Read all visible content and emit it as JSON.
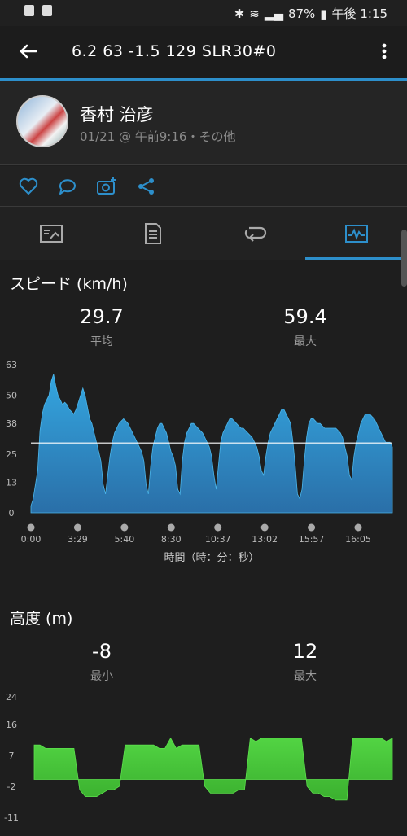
{
  "status_bar": {
    "battery": "87%",
    "time": "午後 1:15"
  },
  "app_bar": {
    "title": "6.2  63  -1.5  129  SLR30#0"
  },
  "user": {
    "name": "香村 治彦",
    "meta": "01/21 @ 午前9:16・その他"
  },
  "tabs": [
    "overview",
    "details",
    "laps",
    "charts"
  ],
  "speed": {
    "title": "スピード (km/h)",
    "avg_value": "29.7",
    "avg_label": "平均",
    "max_value": "59.4",
    "max_label": "最大",
    "x_axis_label": "時間（時：分：秒）",
    "color": "#2d8fcb"
  },
  "altitude": {
    "title": "高度 (m)",
    "min_value": "-8",
    "min_label": "最小",
    "max_value": "12",
    "max_label": "最大",
    "color": "#46c93a"
  },
  "chart_data": [
    {
      "type": "area",
      "title": "スピード (km/h)",
      "xlabel": "時間（時：分：秒）",
      "ylabel": "",
      "y_ticks": [
        "63",
        "50",
        "38",
        "25",
        "13",
        "0"
      ],
      "x_ticks": [
        "0:00",
        "3:29",
        "5:40",
        "8:30",
        "10:37",
        "13:02",
        "15:57",
        "16:05"
      ],
      "ylim": [
        0,
        63
      ],
      "average_line": 29.7,
      "values": [
        3,
        6,
        12,
        18,
        35,
        42,
        46,
        48,
        50,
        56,
        59,
        54,
        50,
        48,
        46,
        47,
        46,
        44,
        43,
        42,
        44,
        47,
        50,
        53,
        50,
        45,
        40,
        38,
        34,
        30,
        26,
        22,
        12,
        8,
        16,
        24,
        30,
        34,
        36,
        38,
        39,
        40,
        39,
        38,
        36,
        34,
        32,
        30,
        28,
        26,
        22,
        12,
        8,
        20,
        28,
        32,
        36,
        38,
        38,
        36,
        34,
        30,
        26,
        24,
        20,
        10,
        8,
        22,
        30,
        34,
        36,
        38,
        38,
        37,
        36,
        35,
        34,
        32,
        30,
        28,
        24,
        16,
        10,
        20,
        30,
        34,
        36,
        38,
        40,
        40,
        39,
        38,
        37,
        36,
        36,
        35,
        34,
        33,
        32,
        30,
        28,
        24,
        18,
        16,
        24,
        30,
        34,
        36,
        38,
        40,
        42,
        44,
        44,
        42,
        40,
        38,
        30,
        20,
        8,
        6,
        10,
        22,
        32,
        38,
        40,
        40,
        39,
        38,
        38,
        37,
        36,
        36,
        36,
        36,
        36,
        36,
        35,
        34,
        32,
        28,
        24,
        16,
        14,
        24,
        30,
        34,
        38,
        40,
        42,
        42,
        42,
        41,
        40,
        38,
        36,
        34,
        32,
        30,
        30,
        30,
        28
      ]
    },
    {
      "type": "area",
      "title": "高度 (m)",
      "y_ticks": [
        "24",
        "16",
        "7",
        "-2",
        "-11"
      ],
      "ylim": [
        -11,
        24
      ],
      "values": [
        10,
        10,
        9,
        9,
        9,
        9,
        9,
        9,
        -3,
        -5,
        -5,
        -5,
        -4,
        -3,
        -3,
        -2,
        10,
        10,
        10,
        10,
        10,
        10,
        9,
        9,
        12,
        9,
        10,
        10,
        10,
        10,
        -2,
        -4,
        -4,
        -4,
        -4,
        -4,
        -3,
        -3,
        12,
        11,
        12,
        12,
        12,
        12,
        12,
        12,
        12,
        12,
        -2,
        -4,
        -4,
        -5,
        -5,
        -6,
        -6,
        -6,
        12,
        12,
        12,
        12,
        12,
        12,
        11,
        12
      ]
    }
  ]
}
